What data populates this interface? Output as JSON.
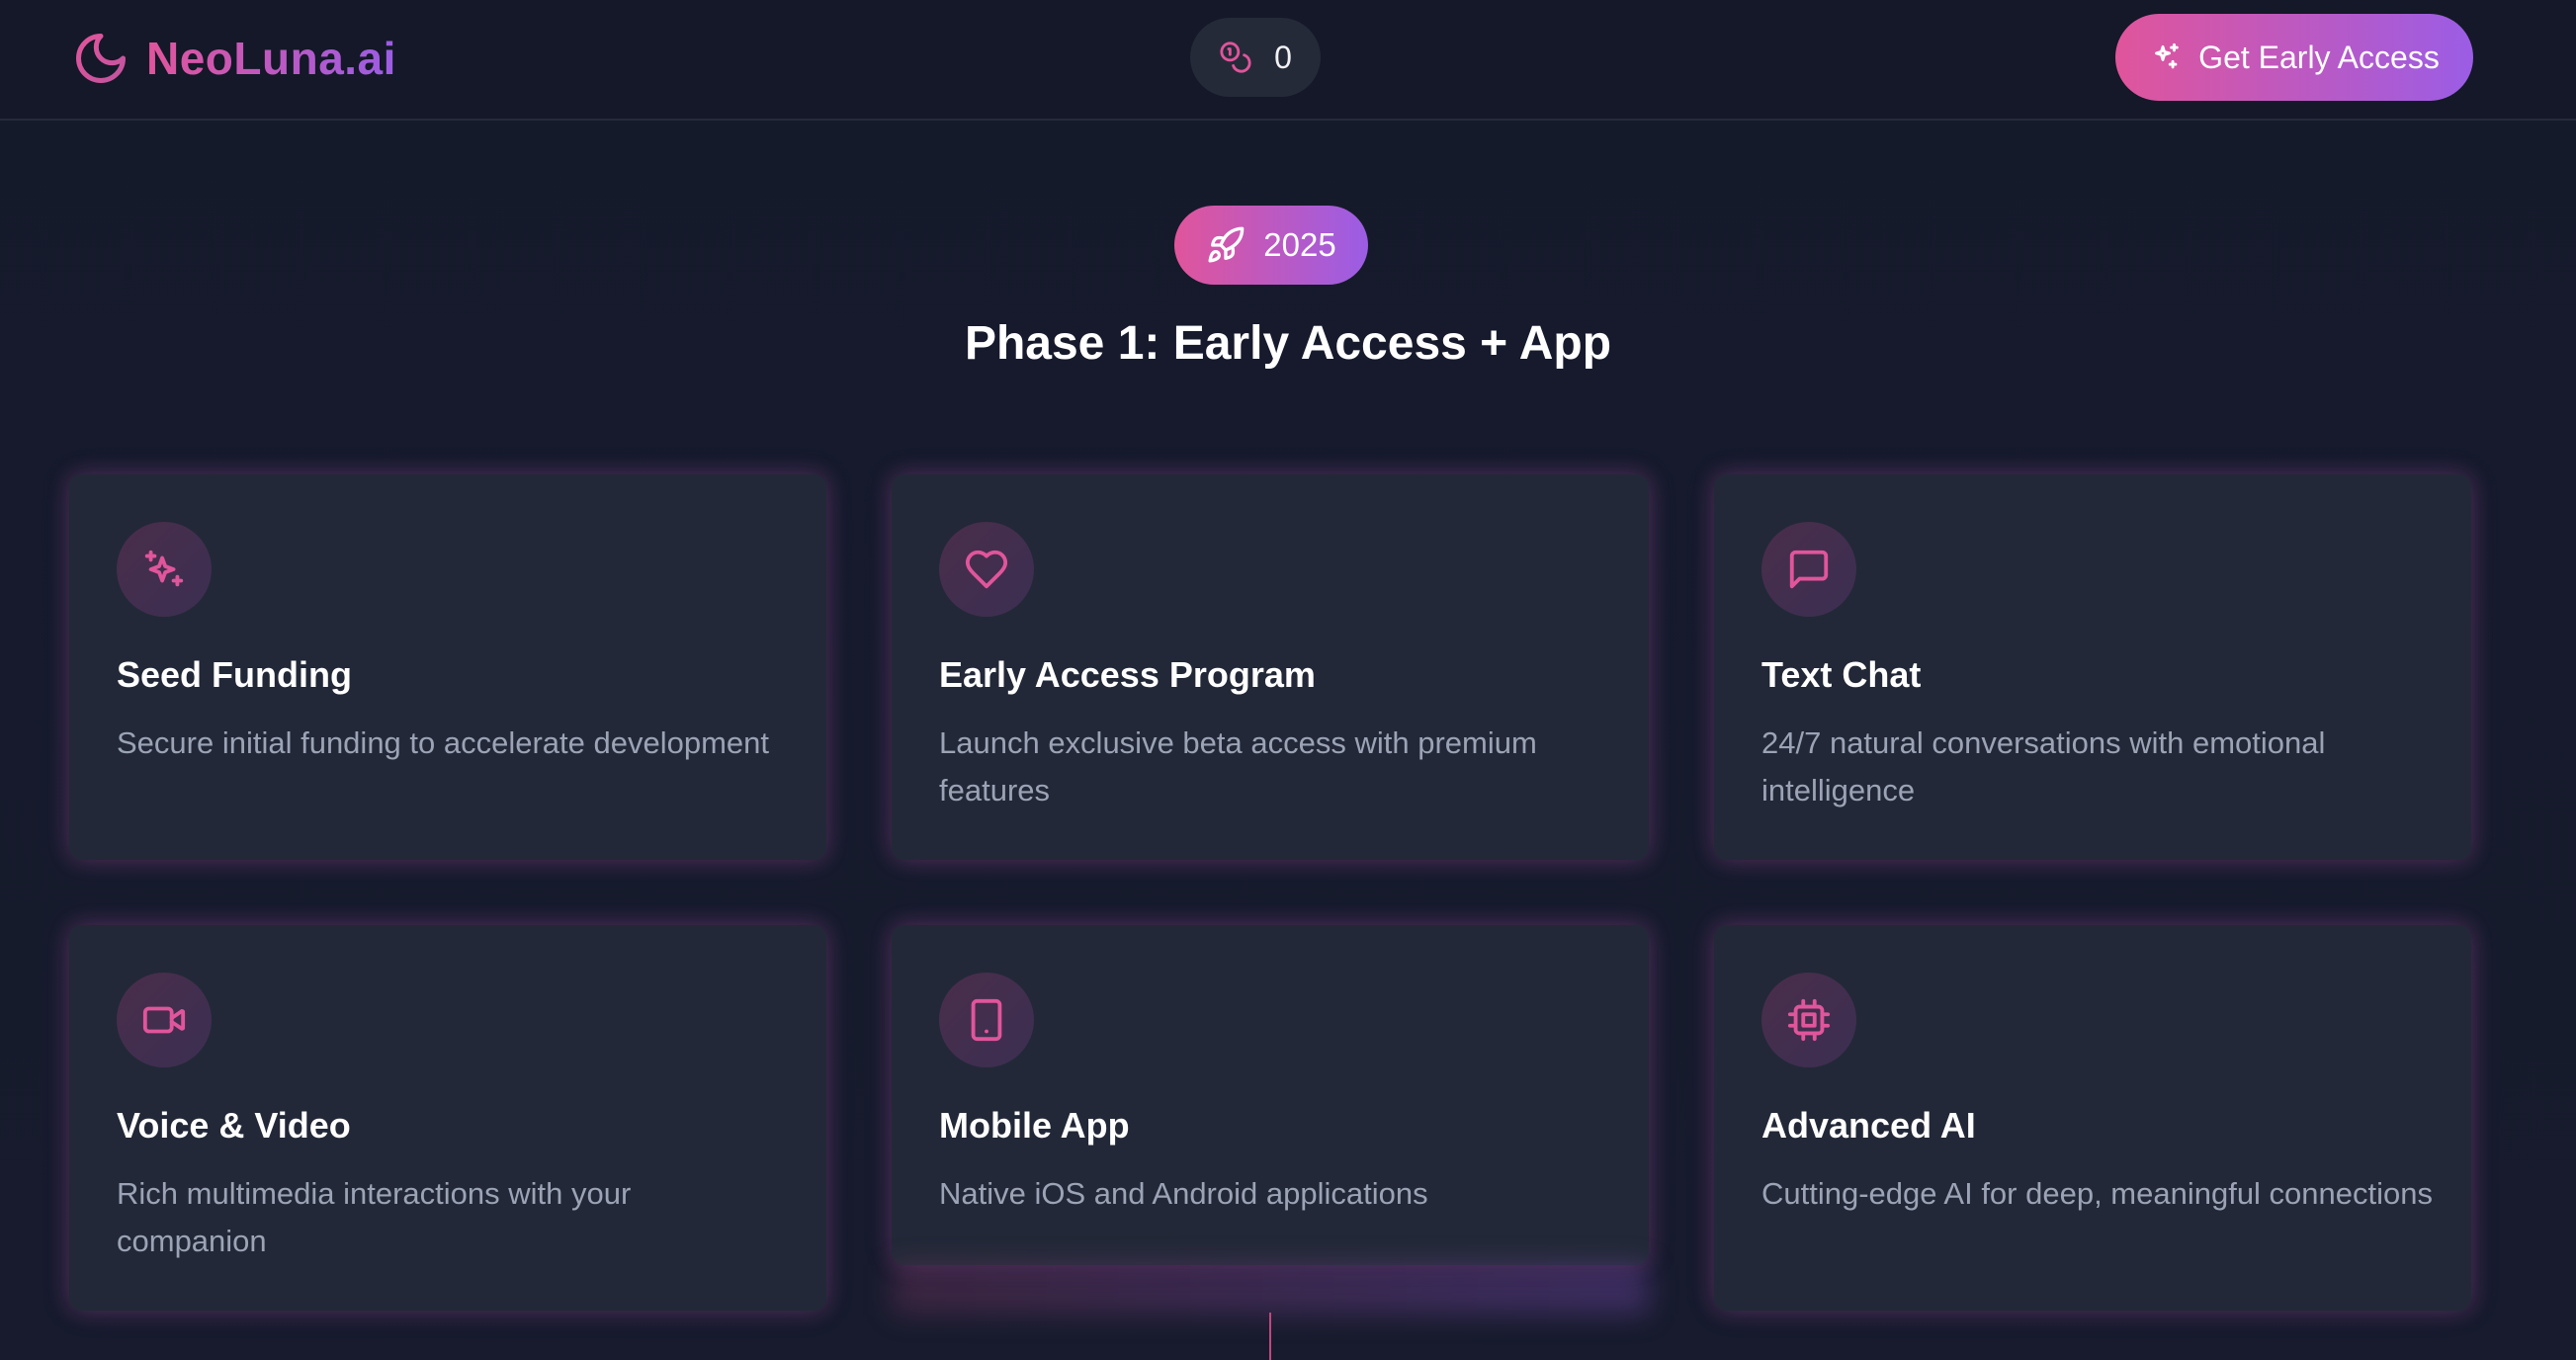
{
  "header": {
    "logo_text": "NeoLuna.ai",
    "counter_value": "0",
    "cta_label": "Get Early Access"
  },
  "hero": {
    "year": "2025",
    "phase_title": "Phase 1: Early Access + App"
  },
  "cards": [
    {
      "icon": "sparkles-icon",
      "title": "Seed Funding",
      "description": "Secure initial funding to accelerate development"
    },
    {
      "icon": "heart-icon",
      "title": "Early Access Program",
      "description": "Launch exclusive beta access with premium features"
    },
    {
      "icon": "chat-bubble-icon",
      "title": "Text Chat",
      "description": "24/7 natural conversations with emotional intelligence"
    },
    {
      "icon": "video-camera-icon",
      "title": "Voice & Video",
      "description": "Rich multimedia interactions with your companion"
    },
    {
      "icon": "smartphone-icon",
      "title": "Mobile App",
      "description": "Native iOS and Android applications"
    },
    {
      "icon": "cpu-chip-icon",
      "title": "Advanced AI",
      "description": "Cutting-edge AI for deep, meaningful connections"
    }
  ],
  "colors": {
    "background": "#161a2b",
    "card": "#222837",
    "accent_pink": "#e0559b",
    "accent_purple": "#9b5de5",
    "muted_text": "#9ba3b5"
  }
}
